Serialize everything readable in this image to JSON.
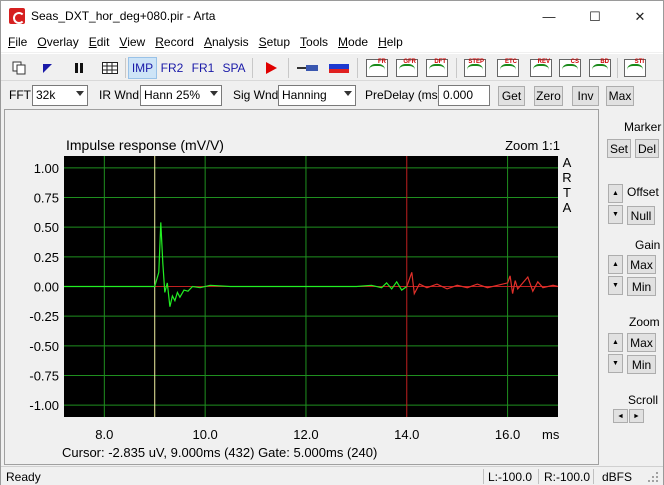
{
  "window": {
    "title": "Seas_DXT_hor_deg+080.pir - Arta",
    "min_glyph": "—",
    "max_glyph": "☐",
    "close_glyph": "✕"
  },
  "menu": [
    {
      "u": "F",
      "rest": "ile"
    },
    {
      "u": "O",
      "rest": "verlay"
    },
    {
      "u": "E",
      "rest": "dit"
    },
    {
      "u": "V",
      "rest": "iew"
    },
    {
      "u": "R",
      "rest": "ecord"
    },
    {
      "u": "A",
      "rest": "nalysis"
    },
    {
      "u": "S",
      "rest": "etup"
    },
    {
      "u": "T",
      "rest": "ools"
    },
    {
      "u": "M",
      "rest": "ode"
    },
    {
      "u": "H",
      "rest": "elp"
    }
  ],
  "toolbar": {
    "modes": [
      "IMP",
      "FR2",
      "FR1",
      "SPA"
    ],
    "active_mode": "IMP",
    "graph_tags": [
      "FR",
      "GFR",
      "DFT",
      "STEP",
      "ETC",
      "REV",
      "CS",
      "BD",
      "STI"
    ]
  },
  "params": {
    "fft_label": "FFT",
    "fft_value": "32k",
    "irwnd_label": "IR Wnd",
    "irwnd_value": "Hann 25%",
    "sigwnd_label": "Sig Wnd",
    "sigwnd_value": "Hanning",
    "predelay_label": "PreDelay (ms)",
    "predelay_value": "0.000",
    "get_label": "Get",
    "zero_label": "Zero",
    "inv_label": "Inv",
    "max_label": "Max"
  },
  "plot": {
    "title": "Impulse response (mV/V)",
    "zoom_label": "Zoom 1:1",
    "side_text": [
      "A",
      "R",
      "T",
      "A"
    ],
    "x_unit": "ms",
    "cursor_text": "Cursor: -2.835 uV, 9.000ms (432)  Gate: 5.000ms (240)",
    "colors": {
      "background": "#000000",
      "grid": "#1f8f1f",
      "signal": "#22ee22",
      "gated": "#e0302a",
      "cursor": "#f0f0a0",
      "gate_line": "#c02020",
      "zero_line": "#c02020"
    }
  },
  "chart_data": {
    "type": "line",
    "title": "Impulse response (mV/V)",
    "xlabel": "ms",
    "ylabel": "",
    "xlim": [
      7.2,
      17.0
    ],
    "ylim": [
      -1.1,
      1.1
    ],
    "x_ticks": [
      "8.0",
      "10.0",
      "12.0",
      "14.0",
      "16.0"
    ],
    "x_tick_values": [
      8.0,
      10.0,
      12.0,
      14.0,
      16.0
    ],
    "y_ticks": [
      "1.00",
      "0.75",
      "0.50",
      "0.25",
      "0.00",
      "-0.25",
      "-0.50",
      "-0.75",
      "-1.00"
    ],
    "y_tick_values": [
      1.0,
      0.75,
      0.5,
      0.25,
      0.0,
      -0.25,
      -0.5,
      -0.75,
      -1.0
    ],
    "cursor_x": 9.0,
    "gate_x": 14.0,
    "series": [
      {
        "x": [
          7.2,
          9.0,
          9.08,
          9.12,
          9.16,
          9.2,
          9.25,
          9.3,
          9.35,
          9.4,
          9.45,
          9.5,
          9.58,
          9.66,
          9.75,
          9.9,
          10.1,
          10.5,
          12.0,
          13.0,
          13.3,
          13.5,
          13.6,
          13.7,
          13.8,
          13.9,
          14.0
        ],
        "values": [
          0.0,
          0.0,
          0.12,
          0.54,
          0.2,
          -0.05,
          0.03,
          -0.17,
          -0.08,
          -0.12,
          -0.05,
          -0.09,
          -0.03,
          -0.04,
          0.0,
          -0.01,
          0.01,
          0.0,
          0.0,
          0.0,
          0.01,
          -0.01,
          0.03,
          -0.02,
          0.04,
          -0.03,
          0.0
        ]
      },
      {
        "x": [
          14.0,
          14.05,
          14.1,
          14.15,
          14.25,
          14.4,
          14.6,
          14.8,
          15.0,
          15.2,
          15.4,
          15.6,
          15.8,
          16.0,
          16.05,
          16.1,
          16.15,
          16.2,
          16.4,
          16.5,
          16.6,
          16.7,
          16.9,
          17.0
        ],
        "values": [
          0.0,
          0.06,
          0.12,
          -0.06,
          0.02,
          -0.01,
          0.02,
          -0.02,
          0.01,
          -0.01,
          0.02,
          -0.01,
          0.01,
          0.03,
          0.09,
          -0.06,
          0.05,
          -0.02,
          0.08,
          -0.04,
          0.04,
          -0.01,
          0.01,
          0.0
        ]
      }
    ]
  },
  "right_panel": {
    "marker_label": "Marker",
    "set_label": "Set",
    "del_label": "Del",
    "offset_label": "Offset",
    "null_label": "Null",
    "gain_label": "Gain",
    "gain_max": "Max",
    "gain_min": "Min",
    "zoom_label": "Zoom",
    "zoom_max": "Max",
    "zoom_min": "Min",
    "scroll_label": "Scroll"
  },
  "status": {
    "ready": "Ready",
    "left": "L:-100.0",
    "right": "R:-100.0",
    "unit": "dBFS"
  }
}
